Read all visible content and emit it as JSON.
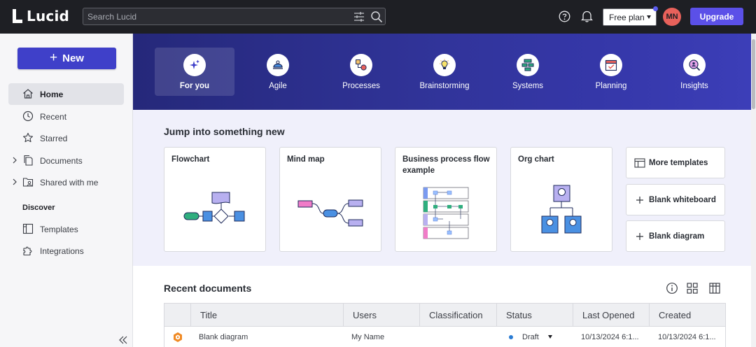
{
  "header": {
    "logo_text": "Lucid",
    "search_placeholder": "Search Lucid",
    "plan_label": "Free plan",
    "avatar_initials": "MN",
    "upgrade_label": "Upgrade"
  },
  "sidebar": {
    "new_label": "New",
    "items": [
      {
        "label": "Home",
        "icon": "home-icon"
      },
      {
        "label": "Recent",
        "icon": "clock-icon"
      },
      {
        "label": "Starred",
        "icon": "star-icon"
      },
      {
        "label": "Documents",
        "icon": "documents-icon"
      },
      {
        "label": "Shared with me",
        "icon": "shared-folder-icon"
      }
    ],
    "discover_label": "Discover",
    "discover_items": [
      {
        "label": "Templates",
        "icon": "templates-icon"
      },
      {
        "label": "Integrations",
        "icon": "puzzle-icon"
      }
    ]
  },
  "categories": [
    {
      "label": "For you",
      "icon": "sparkle-icon"
    },
    {
      "label": "Agile",
      "icon": "agile-icon"
    },
    {
      "label": "Processes",
      "icon": "processes-icon"
    },
    {
      "label": "Brainstorming",
      "icon": "lightbulb-icon"
    },
    {
      "label": "Systems",
      "icon": "systems-icon"
    },
    {
      "label": "Planning",
      "icon": "calendar-icon"
    },
    {
      "label": "Insights",
      "icon": "insights-icon"
    }
  ],
  "jump": {
    "title": "Jump into something new",
    "templates": [
      {
        "name": "Flowchart"
      },
      {
        "name": "Mind map"
      },
      {
        "name": "Business process flow example"
      },
      {
        "name": "Org chart"
      }
    ],
    "side_buttons": [
      {
        "label": "More templates",
        "icon": "templates-icon"
      },
      {
        "label": "Blank whiteboard",
        "icon": "plus-icon"
      },
      {
        "label": "Blank diagram",
        "icon": "plus-icon"
      }
    ]
  },
  "recent": {
    "title": "Recent documents",
    "columns": [
      "Title",
      "Users",
      "Classification",
      "Status",
      "Last Opened",
      "Created"
    ],
    "rows": [
      {
        "title": "Blank diagram",
        "users": "My Name",
        "classification": "",
        "status": "Draft",
        "last_opened": "10/13/2024 6:1...",
        "created": "10/13/2024 6:1..."
      }
    ]
  },
  "colors": {
    "topbar": "#1e1f24",
    "accent": "#5b50e8",
    "new_button": "#3f40c9",
    "banner": "#31349a",
    "avatar": "#e8615b"
  }
}
